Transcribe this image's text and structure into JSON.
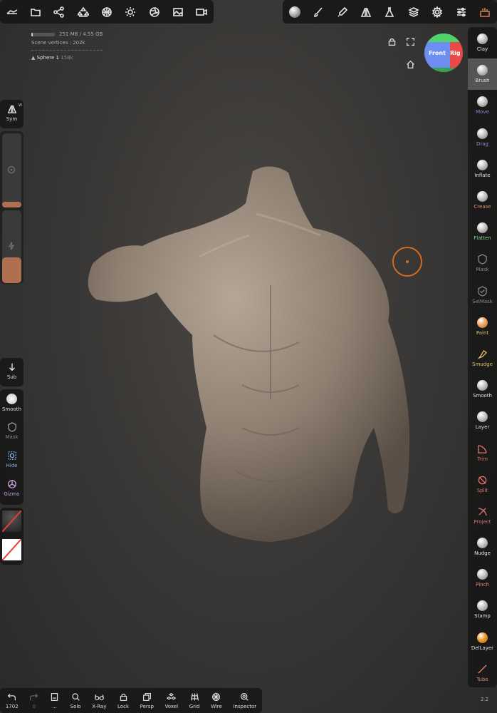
{
  "top_toolbar_left": [
    "nomad-logo-icon",
    "folder-icon",
    "share-graph-icon",
    "scene-icon",
    "globe-icon",
    "sun-icon",
    "aperture-icon",
    "image-icon",
    "camera-icon"
  ],
  "top_toolbar_right": [
    "material-sphere-icon",
    "paint-brush-icon",
    "picker-icon",
    "symmetry-icon",
    "flask-icon",
    "layers-icon",
    "gear-icon",
    "sliders-icon",
    "tools-icon"
  ],
  "stats": {
    "memory": "251 MB / 4.55 GB",
    "memory_fraction": 0.06,
    "scene_vertices": "Scene vertices : 202k",
    "object_name": "Sphere 1",
    "object_vertices": "158k"
  },
  "view_cube": {
    "front": "Front",
    "right": "Rig"
  },
  "left_panel": {
    "sym": "Sym",
    "sym_badge": "W",
    "sub": "Sub",
    "smooth": "Smooth",
    "mask": "Mask",
    "hide": "Hide",
    "gizmo": "Gizmo",
    "radius_fraction": 0.08,
    "intensity_fraction": 0.35
  },
  "tools": [
    {
      "label": "Clay",
      "color": "#e0e0e0"
    },
    {
      "label": "Brush",
      "color": "#e0e0e0",
      "active": true
    },
    {
      "label": "Move",
      "color": "#8a8ad8"
    },
    {
      "label": "Drag",
      "color": "#8a8ad8"
    },
    {
      "label": "Inflate",
      "color": "#e0e0e0"
    },
    {
      "label": "Crease",
      "color": "#e08a6a"
    },
    {
      "label": "Flatten",
      "color": "#8ad08a"
    },
    {
      "label": "Mask",
      "color": "#888888"
    },
    {
      "label": "SelMask",
      "color": "#888888"
    },
    {
      "label": "Paint",
      "color": "#e0c060"
    },
    {
      "label": "Smudge",
      "color": "#e0c060"
    },
    {
      "label": "Smooth",
      "color": "#e0e0e0"
    },
    {
      "label": "Layer",
      "color": "#e0e0e0"
    },
    {
      "label": "Trim",
      "color": "#e07070"
    },
    {
      "label": "Split",
      "color": "#e07070"
    },
    {
      "label": "Project",
      "color": "#e07070"
    },
    {
      "label": "Nudge",
      "color": "#e0e0e0"
    },
    {
      "label": "Pinch",
      "color": "#e08a6a"
    },
    {
      "label": "Stamp",
      "color": "#e0e0e0"
    },
    {
      "label": "DelLayer",
      "color": "#e0e0e0"
    },
    {
      "label": "Tube",
      "color": "#e08a6a"
    }
  ],
  "bottom_bar": [
    {
      "label": "1702",
      "icon": "undo-icon"
    },
    {
      "label": "0",
      "icon": "redo-icon"
    },
    {
      "label": "...",
      "icon": "document-icon"
    },
    {
      "label": "Solo",
      "icon": "search-icon"
    },
    {
      "label": "X-Ray",
      "icon": "glasses-icon"
    },
    {
      "label": "Lock",
      "icon": "lock-icon"
    },
    {
      "label": "Persp",
      "icon": "copy-icon"
    },
    {
      "label": "Voxel",
      "icon": "voxel-icon"
    },
    {
      "label": "Grid",
      "icon": "grid-icon"
    },
    {
      "label": "Wire",
      "icon": "wire-icon"
    },
    {
      "label": "Inspector",
      "icon": "inspector-icon"
    }
  ],
  "version": "2.2"
}
